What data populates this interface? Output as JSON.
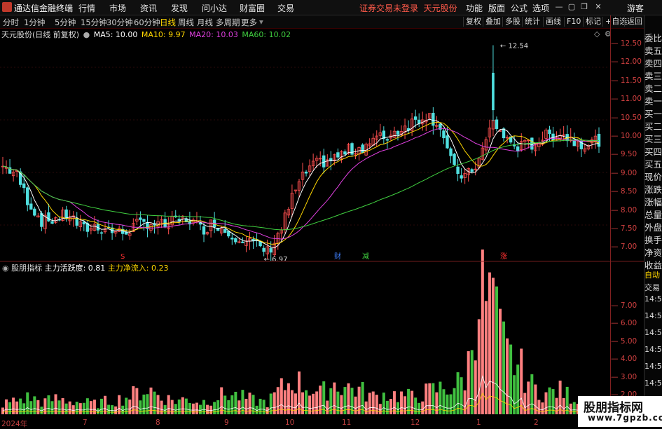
{
  "app": {
    "name": "通达信金融终端",
    "warning": "证券交易未登录",
    "stock_link": "天元股份"
  },
  "menu": [
    "行情",
    "市场",
    "资讯",
    "发现",
    "问小达",
    "财富圈",
    "交易"
  ],
  "toolbar_right": [
    "功能",
    "版面",
    "公式",
    "选项",
    "游客"
  ],
  "periods": [
    "分时",
    "1分钟",
    "5分钟",
    "15分钟",
    "30分钟",
    "60分钟",
    "日线",
    "周线",
    "月线",
    "多周期",
    "更多"
  ],
  "active_period": "日线",
  "chart_buttons": [
    "复权",
    "叠加",
    "多股",
    "统计",
    "画线",
    "F10",
    "标记",
    "+自选",
    "返回"
  ],
  "stock_title": "天元股份(日线 前复权)",
  "ma": [
    {
      "label": "MA5: 10.00",
      "color": "#ffffff"
    },
    {
      "label": "MA10: 9.97",
      "color": "#ffd700"
    },
    {
      "label": "MA20: 10.03",
      "color": "#e040e0"
    },
    {
      "label": "MA60: 10.02",
      "color": "#40d040"
    }
  ],
  "price_high_label": "12.54",
  "price_low_label": "6.97",
  "event_marks": [
    {
      "t": "S",
      "color": "#ff3030"
    },
    {
      "t": "财",
      "color": "#4080ff"
    },
    {
      "t": "减",
      "color": "#40d040"
    },
    {
      "t": "涨",
      "color": "#ff3030"
    }
  ],
  "indicator": {
    "name": "股朋指标",
    "line1": "主力活跃度: 0.81",
    "line2": "主力净流入: 0.23"
  },
  "price_axis": [
    "12.50",
    "12.00",
    "11.50",
    "11.00",
    "10.50",
    "10.00",
    "9.50",
    "9.00",
    "8.50",
    "8.00",
    "7.50",
    "7.00"
  ],
  "ind_axis": [
    "7.00",
    "6.00",
    "5.00",
    "4.00",
    "3.00",
    "2.00"
  ],
  "side_top": [
    "委比",
    "卖五",
    "卖四",
    "卖三",
    "卖二",
    "卖一",
    "买一",
    "买二",
    "买三",
    "买四",
    "买五",
    "现价",
    "涨跌",
    "涨幅",
    "总量",
    "外盘",
    "换手",
    "净资",
    "收益"
  ],
  "side_bottom": [
    "自动",
    "交易",
    "14:56",
    "14:56",
    "14:56",
    "14:56",
    "14:56",
    "14:56",
    "14:56"
  ],
  "x_labels": [
    "2024年",
    "7",
    "8",
    "9",
    "10",
    "11",
    "12",
    "1",
    "2"
  ],
  "watermark": {
    "line1": "股朋指标网",
    "line2": "www.7gpzb.com"
  },
  "colors": {
    "up": "#ff5050",
    "down": "#50e0e0",
    "ma5": "#ffffff",
    "ma10": "#ffd700",
    "ma20": "#e040e0",
    "ma60": "#40d040",
    "bar_up": "#ff8080",
    "bar_down": "#40c040"
  },
  "chart_data": {
    "type": "candlestick",
    "price_range": [
      6.8,
      12.7
    ],
    "highlight_high": 12.54,
    "highlight_low": 6.97,
    "close_anchors": [
      9.3,
      9.1,
      8.3,
      7.8,
      7.9,
      8.0,
      7.6,
      7.7,
      7.6,
      7.5,
      7.7,
      7.8,
      7.7,
      7.8,
      7.9,
      7.6,
      7.8,
      7.5,
      7.4,
      7.2,
      7.0,
      7.6,
      8.6,
      9.2,
      9.4,
      9.5,
      9.7,
      9.8,
      10.0,
      10.1,
      10.3,
      10.5,
      10.7,
      10.4,
      9.2,
      9.0,
      9.5,
      10.5,
      10.0,
      9.8,
      9.9,
      10.1,
      10.2,
      10.0,
      9.9,
      10.0
    ],
    "volume_range": [
      0,
      8
    ],
    "volume_anchors": [
      0.6,
      0.8,
      1.0,
      0.7,
      0.9,
      0.8,
      0.7,
      0.6,
      0.8,
      0.9,
      1.2,
      1.5,
      1.0,
      0.8,
      0.9,
      0.7,
      1.0,
      1.2,
      1.0,
      0.8,
      0.7,
      1.5,
      2.0,
      1.6,
      1.2,
      1.8,
      1.6,
      1.4,
      1.0,
      1.2,
      1.1,
      1.0,
      1.3,
      1.5,
      1.6,
      2.2,
      7.5,
      6.0,
      3.5,
      2.8,
      1.6,
      1.2,
      1.4,
      1.0,
      0.8,
      0.7
    ],
    "series": [
      {
        "name": "主力活跃度"
      },
      {
        "name": "主力净流入"
      }
    ]
  }
}
